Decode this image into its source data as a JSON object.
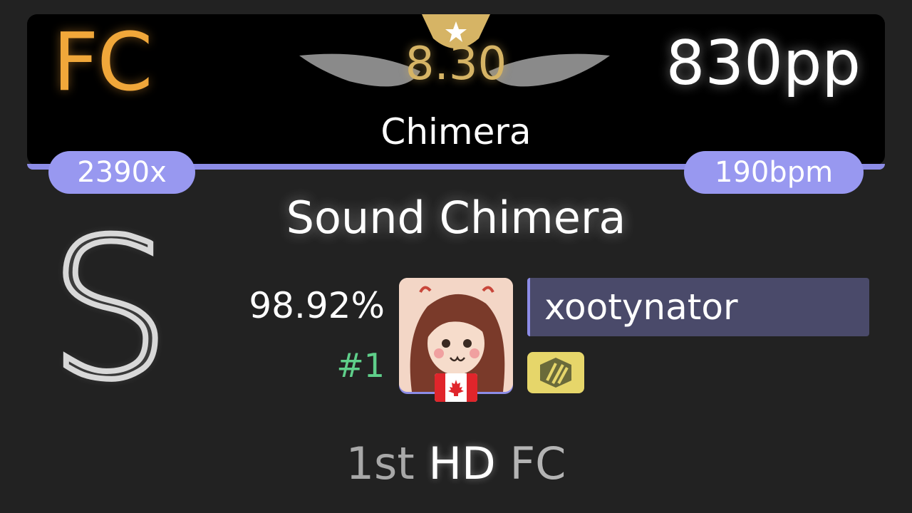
{
  "score": {
    "combo_status": "FC",
    "pp": "830pp",
    "star_rating": "8.30",
    "difficulty_name": "Chimera",
    "max_combo": "2390x",
    "bpm": "190bpm",
    "song_title": "Sound Chimera",
    "grade": "S",
    "accuracy": "98.92%",
    "rank": "#1"
  },
  "player": {
    "username": "xootynator",
    "country_flag": "canada-flag",
    "avatar_icon": "player-avatar",
    "badge_icon": "supporter-badge-icon"
  },
  "footer": {
    "place": "1st",
    "mods": "HD",
    "combo_status": "FC"
  },
  "colors": {
    "background": "#222222",
    "card": "#000000",
    "accent_lavender": "#8c8ce6",
    "fc_orange": "#f0a73a",
    "star_gold": "#d6b465",
    "rank_green": "#5fcf8a",
    "name_box": "#4a4a6a",
    "badge_yellow": "#e6d66a"
  }
}
